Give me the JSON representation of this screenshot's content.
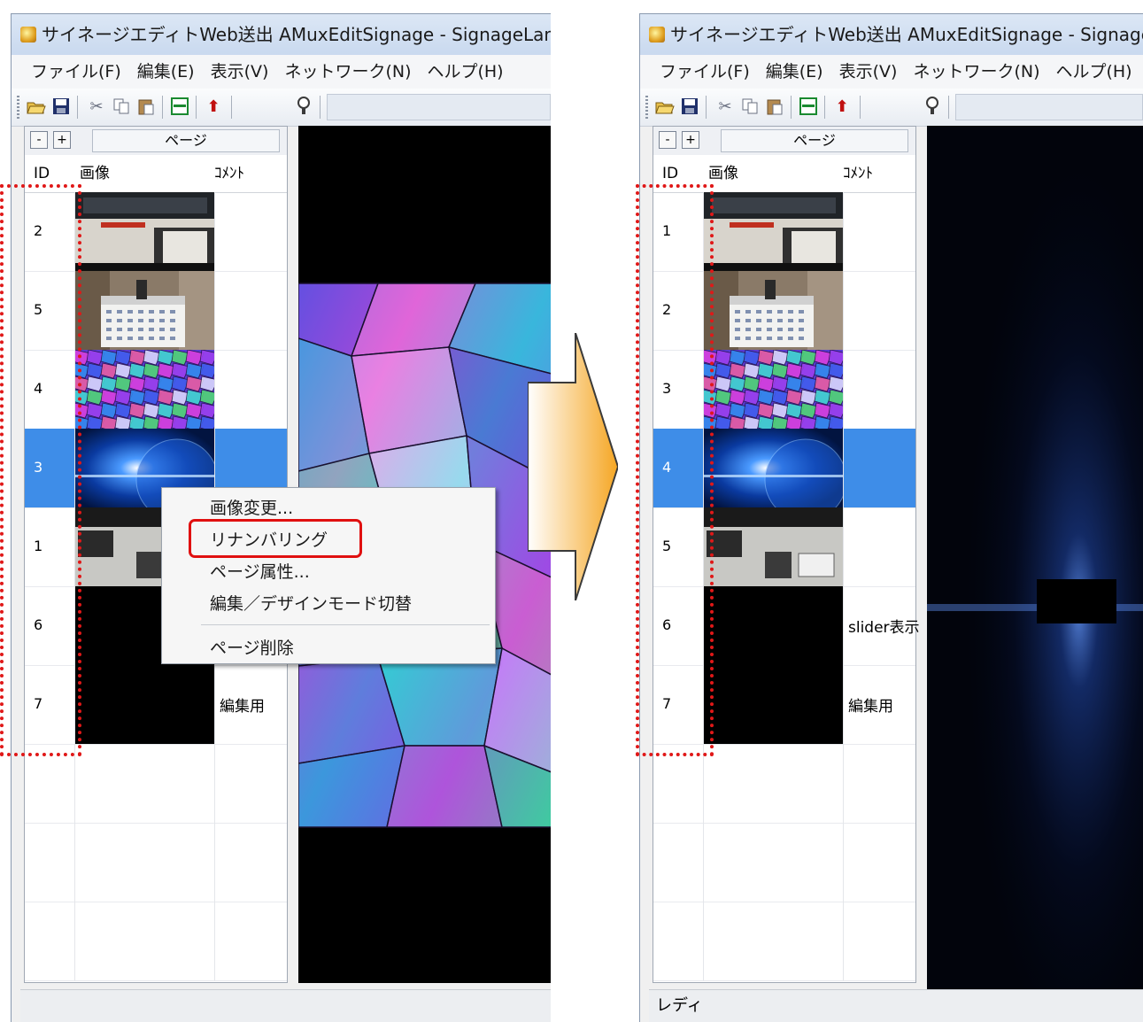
{
  "window_title": "サイネージエディトWeb送出 AMuxEditSignage - SignageLand",
  "menus": [
    "ファイル(F)",
    "編集(E)",
    "表示(V)",
    "ネットワーク(N)",
    "ヘルプ(H)"
  ],
  "page_panel": {
    "title": "ページ",
    "minus": "-",
    "plus": "+",
    "columns": {
      "id": "ID",
      "image": "画像",
      "comment": "ｺﾒﾝﾄ"
    }
  },
  "before": {
    "rows": [
      {
        "id": "2",
        "thumb": "desk-icon",
        "comment": ""
      },
      {
        "id": "5",
        "thumb": "calendar-icon",
        "comment": ""
      },
      {
        "id": "4",
        "thumb": "gems-icon",
        "comment": ""
      },
      {
        "id": "3",
        "thumb": "earth-icon",
        "comment": "",
        "selected": true
      },
      {
        "id": "1",
        "thumb": "keyboard-icon",
        "comment": ""
      },
      {
        "id": "6",
        "thumb": "black-icon",
        "comment": ""
      },
      {
        "id": "7",
        "thumb": "black-icon",
        "comment": "編集用"
      }
    ],
    "status": ""
  },
  "context_menu": {
    "items": [
      "画像変更...",
      "リナンバリング",
      "ページ属性...",
      "編集／デザインモード切替",
      "ページ削除"
    ],
    "highlighted": "リナンバリング"
  },
  "after": {
    "rows": [
      {
        "id": "1",
        "thumb": "desk-icon",
        "comment": ""
      },
      {
        "id": "2",
        "thumb": "calendar-icon",
        "comment": ""
      },
      {
        "id": "3",
        "thumb": "gems-icon",
        "comment": ""
      },
      {
        "id": "4",
        "thumb": "earth-icon",
        "comment": "",
        "selected": true
      },
      {
        "id": "5",
        "thumb": "keyboard-icon",
        "comment": ""
      },
      {
        "id": "6",
        "thumb": "black-icon",
        "comment": "slider表示"
      },
      {
        "id": "7",
        "thumb": "black-icon",
        "comment": "編集用"
      }
    ],
    "status": "レディ"
  },
  "colors": {
    "selection": "#3e8de8",
    "highlight": "#e01010",
    "arrow": "#f5a623"
  }
}
